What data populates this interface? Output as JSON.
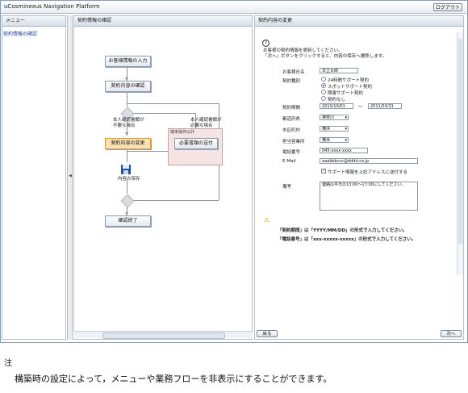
{
  "app": {
    "title": "uCosminexus Navigation Platform",
    "logout_label": "ログアウト"
  },
  "menu": {
    "header": "メニュー",
    "items": [
      {
        "label": "契約情報の確認"
      }
    ],
    "splitter_glyph": "◀"
  },
  "flow": {
    "header": "契約情報の確認",
    "nodes": {
      "input": "お客様情報の入力",
      "confirm": "契約内容の確認",
      "change": "契約内容の変更",
      "send_docs": "必要書類の送付",
      "save": "内容の保存",
      "end": "確認終了"
    },
    "branch_left": "本人確認書類が\n不要な場合",
    "branch_right": "本人確認書類が\n必要な場合",
    "external_label": "端末操作以外"
  },
  "form": {
    "header": "契約内容の変更",
    "help_icon": "?",
    "instructions": "お客様の契約情報を更新してください。\n「次へ」ボタンをクリックすると、内容の保存へ遷移します。",
    "fields": {
      "name": {
        "label": "お客様氏名",
        "value": "日立太郎"
      },
      "contract_type": {
        "label": "契約種別",
        "options": [
          "24時間サポート契約",
          "スポットサポート契約",
          "障害サポート契約",
          "契約なし"
        ],
        "selected": 1
      },
      "period": {
        "label": "契約期間",
        "from": "2010/10/01",
        "sep": "〜",
        "to": "2011/03/31"
      },
      "prefecture": {
        "label": "都道府県",
        "value": "神奈川"
      },
      "city": {
        "label": "市区町村",
        "value": "横浜"
      },
      "office": {
        "label": "担当営業所",
        "value": "横浜"
      },
      "phone": {
        "label": "電話番号",
        "value": "045-xxxx-xxxx"
      },
      "email": {
        "label": "E-Mail",
        "value": "aaabbbccc@dddd.co.jp"
      },
      "sendinfo": {
        "label": "サポート情報を上記アドレスに送付する",
        "checked": true
      },
      "remarks": {
        "label": "備考",
        "value": "連絡は平日の13:00〜17:00にしてください。"
      }
    },
    "warning_icon": "⚠",
    "notes": [
      "「契約期間」は「YYYY/MM/DD」の形式で入力してください。",
      "「電話番号」は「xxx-xxxxx-xxxxx」の形式で入力してください。"
    ],
    "back_label": "戻る",
    "next_label": "次へ"
  },
  "footnote": {
    "title": "注",
    "body": "構築時の設定によって，メニューや業務フローを非表示にすることができます。"
  }
}
